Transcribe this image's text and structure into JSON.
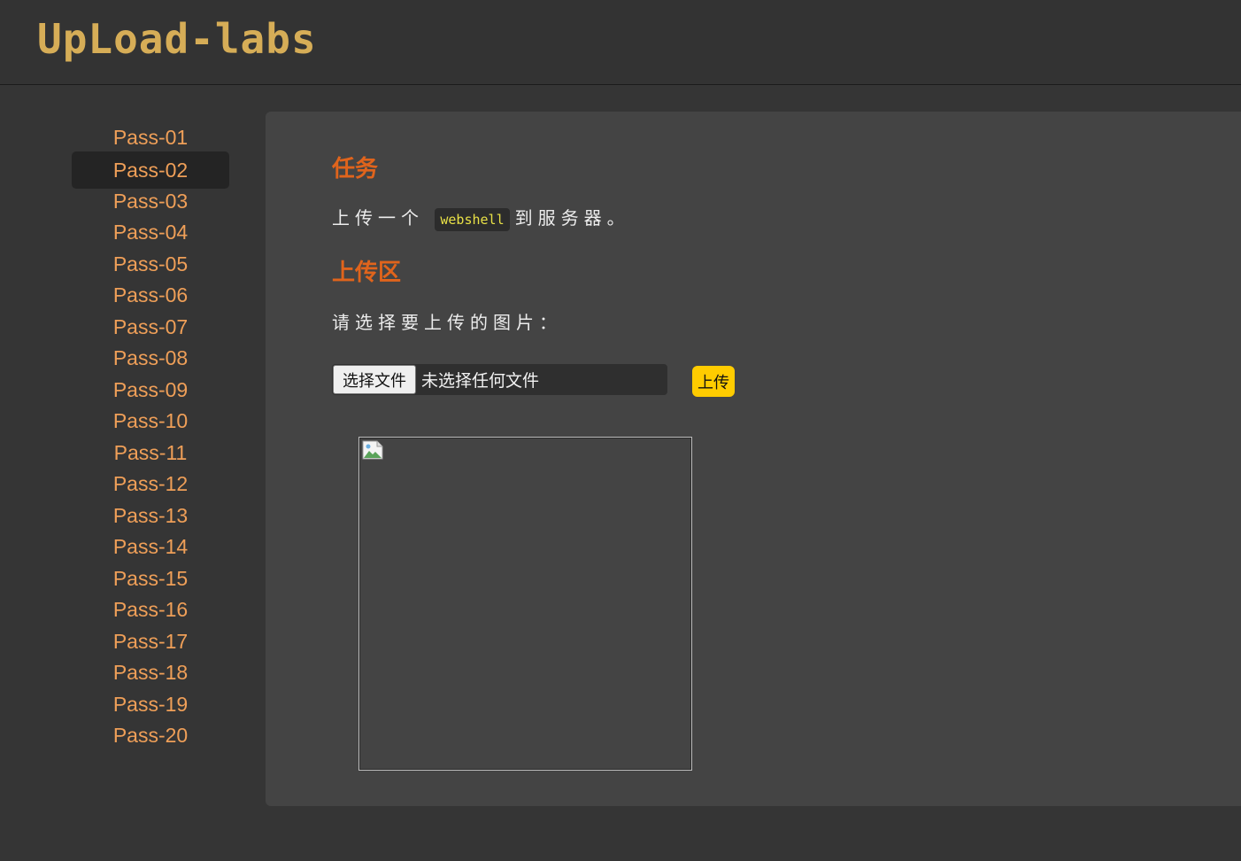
{
  "header": {
    "logo_text": "UpLoad-labs"
  },
  "sidebar": {
    "items": [
      {
        "label": "Pass-01"
      },
      {
        "label": "Pass-02"
      },
      {
        "label": "Pass-03"
      },
      {
        "label": "Pass-04"
      },
      {
        "label": "Pass-05"
      },
      {
        "label": "Pass-06"
      },
      {
        "label": "Pass-07"
      },
      {
        "label": "Pass-08"
      },
      {
        "label": "Pass-09"
      },
      {
        "label": "Pass-10"
      },
      {
        "label": "Pass-11"
      },
      {
        "label": "Pass-12"
      },
      {
        "label": "Pass-13"
      },
      {
        "label": "Pass-14"
      },
      {
        "label": "Pass-15"
      },
      {
        "label": "Pass-16"
      },
      {
        "label": "Pass-17"
      },
      {
        "label": "Pass-18"
      },
      {
        "label": "Pass-19"
      },
      {
        "label": "Pass-20"
      }
    ],
    "active_label": "Pass-02"
  },
  "main": {
    "task_heading": "任务",
    "task_prefix": "上传一个",
    "task_code": "webshell",
    "task_suffix": "到服务器。",
    "upload_heading": "上传区",
    "upload_prompt": "请选择要上传的图片：",
    "file_button_label": "选择文件",
    "file_status": "未选择任何文件",
    "upload_button_label": "上传"
  },
  "colors": {
    "accent_orange": "#e0641c",
    "nav_link": "#ef9f58",
    "logo_gold": "#d6ad57",
    "upload_button": "#ffcc00",
    "code_text": "#e8e046"
  },
  "icons": {
    "preview_image": "broken-image-icon"
  }
}
